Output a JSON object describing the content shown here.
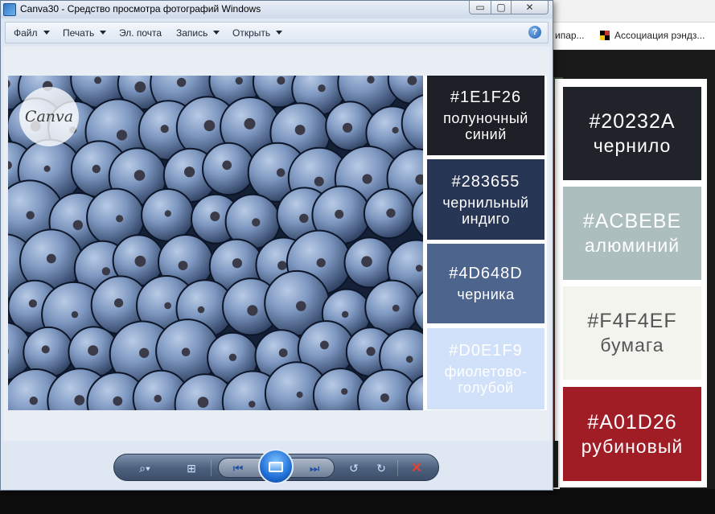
{
  "window": {
    "title": "Canva30 - Средство просмотра фотографий Windows",
    "caption_min": "▭",
    "caption_max": "▢",
    "caption_close": "✕"
  },
  "menu": {
    "items": [
      {
        "label": "Файл"
      },
      {
        "label": "Печать"
      },
      {
        "label": "Эл. почта"
      },
      {
        "label": "Запись"
      },
      {
        "label": "Открыть"
      }
    ],
    "help_glyph": "?"
  },
  "image": {
    "logo_text": "Canva",
    "swatches": [
      {
        "hex": "#1E1F26",
        "name_lines": [
          "полуночный",
          "синий"
        ],
        "color": "#1E1F26",
        "text_color": "#ffffff"
      },
      {
        "hex": "#283655",
        "name_lines": [
          "чернильный",
          "индиго"
        ],
        "color": "#283655",
        "text_color": "#ffffff"
      },
      {
        "hex": "#4D648D",
        "name_lines": [
          "черника"
        ],
        "color": "#4D648D",
        "text_color": "#ffffff"
      },
      {
        "hex": "#D0E1F9",
        "name_lines": [
          "фиолетово-",
          "голубой"
        ],
        "color": "#D0E1F9",
        "text_color": "#ffffff"
      }
    ]
  },
  "background_page": {
    "bookmarks": [
      "ипар...",
      "Ассоциация рэндз..."
    ],
    "swatches": [
      {
        "hex": "#20232A",
        "name": "чернило",
        "color": "#20232A",
        "text_color": "#ffffff"
      },
      {
        "hex": "#ACBEBE",
        "name": "алюминий",
        "color": "#ACBEBE",
        "text_color": "#ffffff"
      },
      {
        "hex": "#F4F4EF",
        "name": "бумага",
        "color": "#F4F4EF",
        "text_color": "#555555"
      },
      {
        "hex": "#A01D26",
        "name": "рубиновый",
        "color": "#A01D26",
        "text_color": "#ffffff"
      }
    ]
  },
  "toolbar": {
    "icons": [
      "magnifier-icon",
      "actual-size-icon",
      "previous-icon",
      "slideshow-icon",
      "next-icon",
      "rotate-left-icon",
      "rotate-right-icon",
      "delete-icon"
    ],
    "glyphs": {
      "zoom": "⌕▾",
      "fit": "⊞",
      "prev": "⏮",
      "next": "⏭",
      "rot_l": "↺",
      "rot_r": "↻",
      "delete": "✕"
    }
  }
}
